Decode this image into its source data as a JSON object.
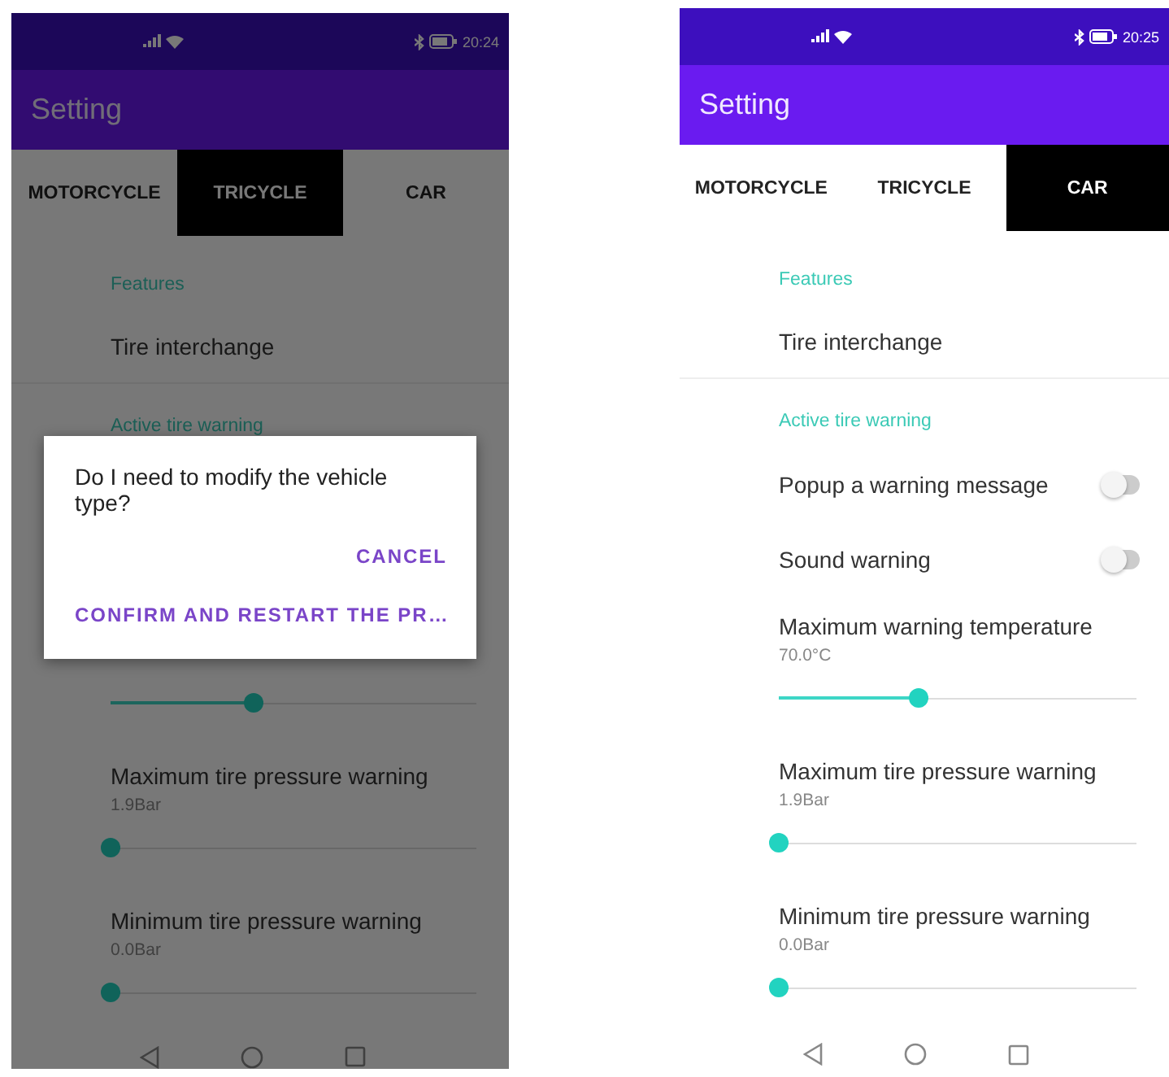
{
  "phones": [
    {
      "status_bar": {
        "time": "20:24"
      },
      "app_bar": {
        "title": "Setting"
      },
      "tabs": [
        {
          "label": "MOTORCYCLE",
          "selected": false
        },
        {
          "label": "TRICYCLE",
          "selected": true
        },
        {
          "label": "CAR",
          "selected": false
        }
      ],
      "settings": [
        {
          "kind": "header",
          "text": "Features"
        },
        {
          "kind": "item",
          "title": "Tire interchange",
          "divider": true
        },
        {
          "kind": "header",
          "text": "Active tire warning"
        },
        {
          "kind": "slider",
          "level": 0.4
        },
        {
          "kind": "slider",
          "title": "Maximum tire pressure warning",
          "value": "1.9Bar",
          "level": 0
        },
        {
          "kind": "slider",
          "title": "Minimum tire pressure warning",
          "value": "0.0Bar",
          "level": 0
        }
      ],
      "dialog": {
        "message": "Do I need to modify the vehicle type?",
        "buttons": [
          "CANCEL",
          "CONFIRM AND RESTART THE PR…"
        ]
      }
    },
    {
      "status_bar": {
        "time": "20:25"
      },
      "app_bar": {
        "title": "Setting"
      },
      "tabs": [
        {
          "label": "MOTORCYCLE",
          "selected": false
        },
        {
          "label": "TRICYCLE",
          "selected": false
        },
        {
          "label": "CAR",
          "selected": true
        }
      ],
      "settings": [
        {
          "kind": "header",
          "text": "Features"
        },
        {
          "kind": "item",
          "title": "Tire interchange",
          "divider": true
        },
        {
          "kind": "header",
          "text": "Active tire warning"
        },
        {
          "kind": "toggle",
          "title": "Popup a warning message",
          "checked": false
        },
        {
          "kind": "toggle",
          "title": "Sound warning",
          "checked": false
        },
        {
          "kind": "slider",
          "title": "Maximum warning temperature",
          "value": "70.0°C",
          "level": 0.4
        },
        {
          "kind": "slider",
          "title": "Maximum tire pressure warning",
          "value": "1.9Bar",
          "level": 0
        },
        {
          "kind": "slider",
          "title": "Minimum tire pressure warning",
          "value": "0.0Bar",
          "level": 0
        }
      ]
    }
  ]
}
